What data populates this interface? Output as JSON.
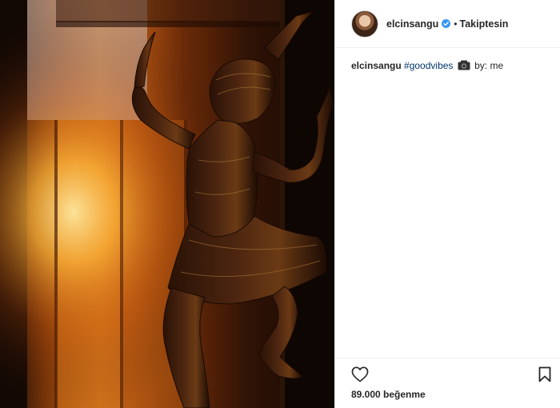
{
  "post": {
    "author": {
      "username": "elcinsangu",
      "verified": true,
      "verified_icon": "verified-badge-icon",
      "follow_separator": "•",
      "follow_state": "Takiptesin"
    },
    "caption": {
      "username": "elcinsangu",
      "hashtag": "#goodvibes",
      "camera_icon": "camera-icon",
      "text": "by: me"
    },
    "actions": {
      "like_icon": "heart-outline-icon",
      "save_icon": "bookmark-outline-icon"
    },
    "likes_text": "89.000 beğenme"
  },
  "colors": {
    "link": "#003569",
    "text": "#262626",
    "verified": "#3897f0",
    "border": "#efefef"
  }
}
